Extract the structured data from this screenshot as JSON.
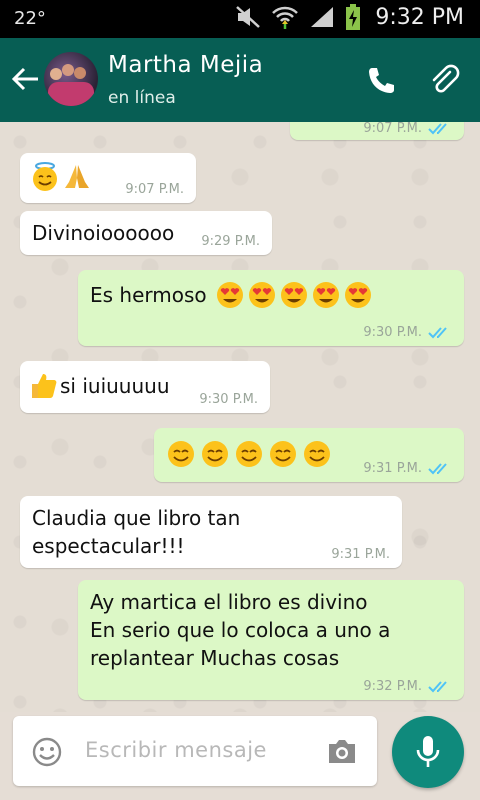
{
  "status_bar": {
    "temperature": "22°",
    "time": "9:32 PM"
  },
  "header": {
    "contact_name": "Martha Mejia",
    "presence": "en línea"
  },
  "messages": [
    {
      "direction": "outgoing",
      "text": "",
      "time": "9:07 P.M.",
      "status": "read"
    },
    {
      "direction": "incoming",
      "text": "",
      "emojis": [
        "smiling-face-with-halo",
        "folded-hands"
      ],
      "time": "9:07 P.M."
    },
    {
      "direction": "incoming",
      "text": "Divinoioooooo",
      "time": "9:29 P.M."
    },
    {
      "direction": "outgoing",
      "text": "Es hermoso",
      "emojis": [
        "heart-eyes",
        "heart-eyes",
        "heart-eyes",
        "heart-eyes",
        "heart-eyes"
      ],
      "time": "9:30 P.M.",
      "status": "read"
    },
    {
      "direction": "incoming",
      "text": "si iuiuuuuu",
      "emojis": [
        "thumbs-up"
      ],
      "time": "9:30 P.M."
    },
    {
      "direction": "outgoing",
      "text": "",
      "emojis": [
        "smiling-face",
        "smiling-face",
        "smiling-face",
        "smiling-face",
        "smiling-face"
      ],
      "time": "9:31 P.M.",
      "status": "read"
    },
    {
      "direction": "incoming",
      "text": "Claudia que libro tan\nespectacular!!!",
      "time": "9:31 P.M."
    },
    {
      "direction": "outgoing",
      "text": "Ay martica el libro es divino\nEn serio que lo coloca a uno a\nreplantear Muchas cosas",
      "time": "9:32 P.M.",
      "status": "read"
    }
  ],
  "composer": {
    "placeholder": "Escribir mensaje"
  },
  "colors": {
    "header": "#075e54",
    "outgoing_bubble": "#dcf8c6",
    "incoming_bubble": "#ffffff",
    "read_ticks": "#4fc3f7",
    "mic_button": "#0f8a7c"
  }
}
